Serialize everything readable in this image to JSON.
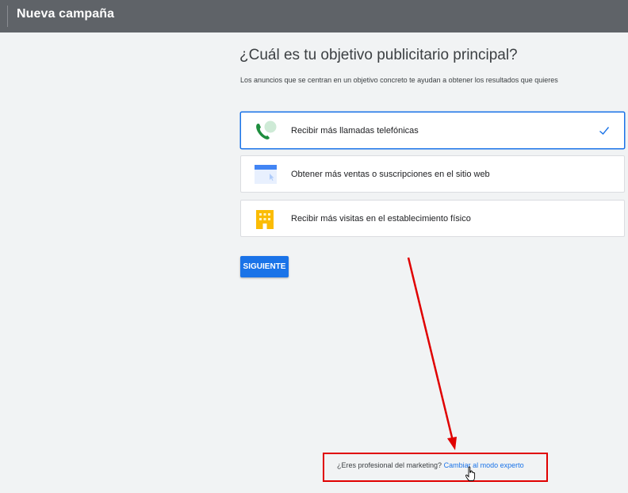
{
  "header": {
    "title": "Nueva campaña"
  },
  "main": {
    "heading": "¿Cuál es tu objetivo publicitario principal?",
    "subheading": "Los anuncios que se centran en un objetivo concreto te ayudan a obtener los resultados que quieres",
    "options": [
      {
        "label": "Recibir más llamadas telefónicas",
        "icon": "phone-call-icon",
        "selected": true
      },
      {
        "label": "Obtener más ventas o suscripciones en el sitio web",
        "icon": "website-icon",
        "selected": false
      },
      {
        "label": "Recibir más visitas en el establecimiento físico",
        "icon": "store-building-icon",
        "selected": false
      }
    ],
    "next_button": "SIGUIENTE"
  },
  "footer": {
    "question": "¿Eres profesional del marketing?",
    "link": "Cambiar al modo experto"
  },
  "colors": {
    "accent": "#1a73e8",
    "annotation": "#e00000",
    "topbar": "#5f6368"
  }
}
